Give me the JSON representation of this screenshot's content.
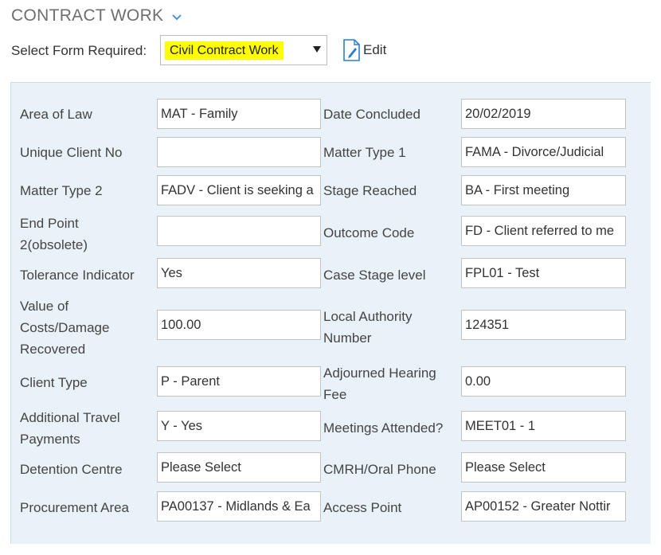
{
  "header": {
    "title": "CONTRACT WORK",
    "collapse_icon": "chevron-down-icon"
  },
  "form_select": {
    "label": "Select Form Required:",
    "selected": "Civil Contract Work",
    "highlight_color": "#ffff00",
    "edit_label": "Edit",
    "edit_icon": "document-edit-icon"
  },
  "fields": {
    "area_of_law": {
      "label": "Area of Law",
      "value": "MAT - Family"
    },
    "date_concluded": {
      "label": "Date Concluded",
      "value": "20/02/2019"
    },
    "unique_client_no": {
      "label": "Unique Client No",
      "value": ""
    },
    "matter_type_1": {
      "label": "Matter Type 1",
      "value": "FAMA - Divorce/Judicial"
    },
    "matter_type_2": {
      "label": "Matter Type 2",
      "value": "FADV - Client is seeking a"
    },
    "stage_reached": {
      "label": "Stage Reached",
      "value": "BA - First meeting"
    },
    "end_point_2": {
      "label_line1": "End Point",
      "label_line2": "2(obsolete)",
      "value": ""
    },
    "outcome_code": {
      "label": "Outcome Code",
      "value": "FD - Client referred to me"
    },
    "tolerance_indicator": {
      "label": "Tolerance Indicator",
      "value": "Yes"
    },
    "case_stage_level": {
      "label": "Case Stage level",
      "value": "FPL01 - Test"
    },
    "value_recovered": {
      "label_line1": "Value of",
      "label_line2": "Costs/Damage",
      "label_line3": "Recovered",
      "value": "100.00"
    },
    "local_authority_number": {
      "label_line1": "Local Authority",
      "label_line2": "Number",
      "value": "124351"
    },
    "client_type": {
      "label": "Client Type",
      "value": "P - Parent"
    },
    "adjourned_hearing_fee": {
      "label_line1": "Adjourned Hearing",
      "label_line2": "Fee",
      "value": "0.00"
    },
    "additional_travel": {
      "label_line1": "Additional Travel",
      "label_line2": "Payments",
      "value": "Y - Yes"
    },
    "meetings_attended": {
      "label": "Meetings Attended?",
      "value": "MEET01 - 1"
    },
    "detention_centre": {
      "label": "Detention Centre",
      "value": "Please Select"
    },
    "cmrh_oral_phone": {
      "label": "CMRH/Oral Phone",
      "value": "Please Select"
    },
    "procurement_area": {
      "label": "Procurement Area",
      "value": "PA00137 - Midlands & Ea"
    },
    "access_point": {
      "label": "Access Point",
      "value": "AP00152 - Greater Nottir"
    }
  }
}
